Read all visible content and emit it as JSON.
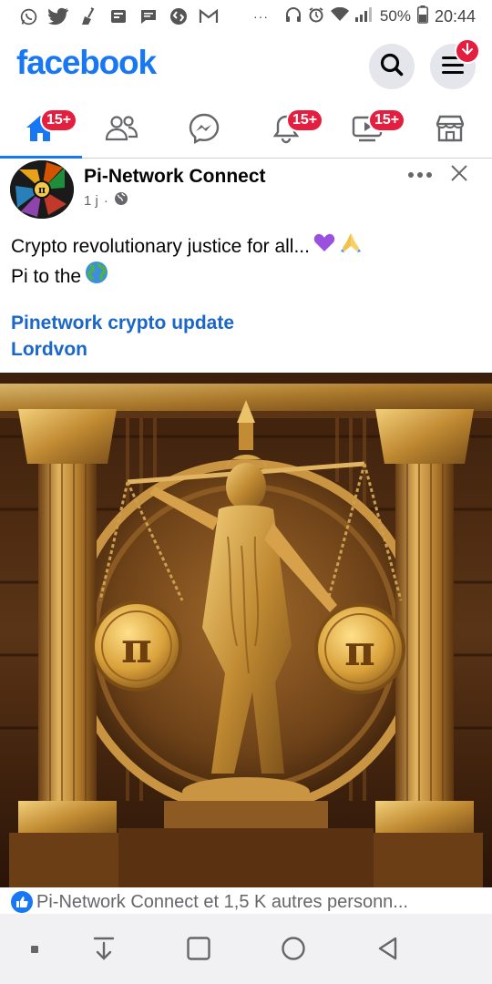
{
  "status_bar": {
    "left_icons": [
      "whatsapp-icon",
      "twitter-icon",
      "broom-icon",
      "sim-icon",
      "message-icon",
      "shazam-icon",
      "gmail-icon"
    ],
    "overflow": "···",
    "battery": "50%",
    "time": "20:44"
  },
  "header": {
    "logo": "facebook",
    "menu_badge_icon": "arrow-down-icon"
  },
  "tabs": [
    {
      "name": "home",
      "badge": "15+"
    },
    {
      "name": "friends",
      "badge": ""
    },
    {
      "name": "messenger",
      "badge": ""
    },
    {
      "name": "notifications",
      "badge": "15+"
    },
    {
      "name": "video",
      "badge": "15+"
    },
    {
      "name": "marketplace",
      "badge": ""
    }
  ],
  "post": {
    "page_name": "Pi-Network Connect",
    "time": "1 j",
    "separator": "·",
    "audience_icon": "globe-icon",
    "text_line1": "Crypto revolutionary justice for all...",
    "text_line2": "Pi to the",
    "link1": "Pinetwork crypto update",
    "link2": "Lordvon",
    "image_alt": "Golden Lady Justice statue holding scales with Pi coins between columns",
    "reactions": "Pi-Network Connect et 1,5 K autres personn..."
  },
  "colors": {
    "brand": "#1877f2",
    "badge": "#e41e3f",
    "link": "#1b67c9"
  }
}
